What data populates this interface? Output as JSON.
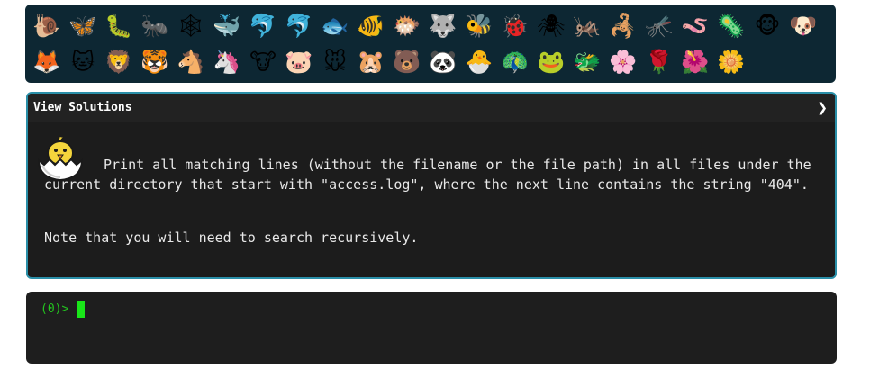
{
  "emoji_bar": {
    "row1": [
      "🐌",
      "🦋",
      "🐛",
      "🐜",
      "🕸",
      "🐳",
      "🐬",
      "🐬",
      "🐟",
      "🐠",
      "🐡",
      "🐺",
      "🐝",
      "🐞",
      "🕷",
      "🦗",
      "🦂",
      "🦟",
      "🪱",
      "🦠",
      "🐵",
      "🐶"
    ],
    "row2": [
      "🦊",
      "🐱",
      "🦁",
      "🐯",
      "🐴",
      "🦄",
      "🐮",
      "🐷",
      "🐭",
      "🐹",
      "🐻",
      "🐼",
      "🐣",
      "🦚",
      "🐸",
      "🐲",
      "🌸",
      "🌹",
      "🌺",
      "🌼"
    ]
  },
  "solutions_panel": {
    "header": "View Solutions",
    "chevron": "❯",
    "avatar_icon": "hatching-chick-icon",
    "description": "Print all matching lines (without the filename or the file path) in all files under the current directory that start with \"access.log\", where the next line contains the string \"404\".",
    "note": "Note that you will need to search recursively."
  },
  "terminal": {
    "prompt": "(0)>",
    "input_value": ""
  },
  "colors": {
    "emoji_bar_bg": "#0d2733",
    "panel_border": "#2a8fa8",
    "prompt_green": "#23c41f",
    "cursor_green": "#19e619"
  }
}
